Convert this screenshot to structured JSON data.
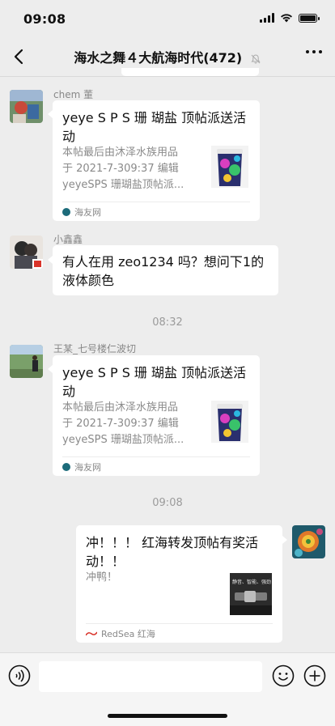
{
  "status_bar": {
    "time": "09:08"
  },
  "chat": {
    "title": "海水之舞４大航海时代(472)"
  },
  "messages": [
    {
      "sender": "chem 董",
      "card": {
        "title": "yeye S P S 珊 瑚盐 顶帖派送活动",
        "desc_line1": "本帖最后由沐泽水族用品",
        "desc_line2": "于 2021-7-309:37 编辑",
        "desc_line3": "yeyeSPS 珊瑚盐顶帖派...",
        "source": "海友网"
      }
    },
    {
      "sender": "小鑫鑫",
      "text_line1": "有人在用 zeo1234 吗？想问下1的",
      "text_line2": "液体颜色"
    },
    {
      "timestamp": "08:32"
    },
    {
      "sender": "王某_七号楼仁波切",
      "card": {
        "title": "yeye S P S 珊 瑚盐 顶帖派送活动",
        "desc_line1": "本帖最后由沐泽水族用品",
        "desc_line2": "于 2021-7-309:37 编辑",
        "desc_line3": "yeyeSPS 珊瑚盐顶帖派...",
        "source": "海友网"
      }
    },
    {
      "timestamp": "09:08"
    },
    {
      "self": true,
      "card": {
        "title": "冲！！！ 红海转发顶帖有奖活动！！",
        "desc_line1": "冲鸭！",
        "source": "RedSea 红海",
        "thumb_text": "静音、智能、强劲"
      }
    }
  ],
  "colors": {
    "background": "#ededed",
    "bubble": "#ffffff",
    "muted_text": "#888888",
    "source_icon": "#1c6b7a"
  },
  "icons": [
    "back-chevron-icon",
    "mute-bell-icon",
    "more-dots-icon",
    "voice-icon",
    "emoji-icon",
    "plus-icon"
  ]
}
